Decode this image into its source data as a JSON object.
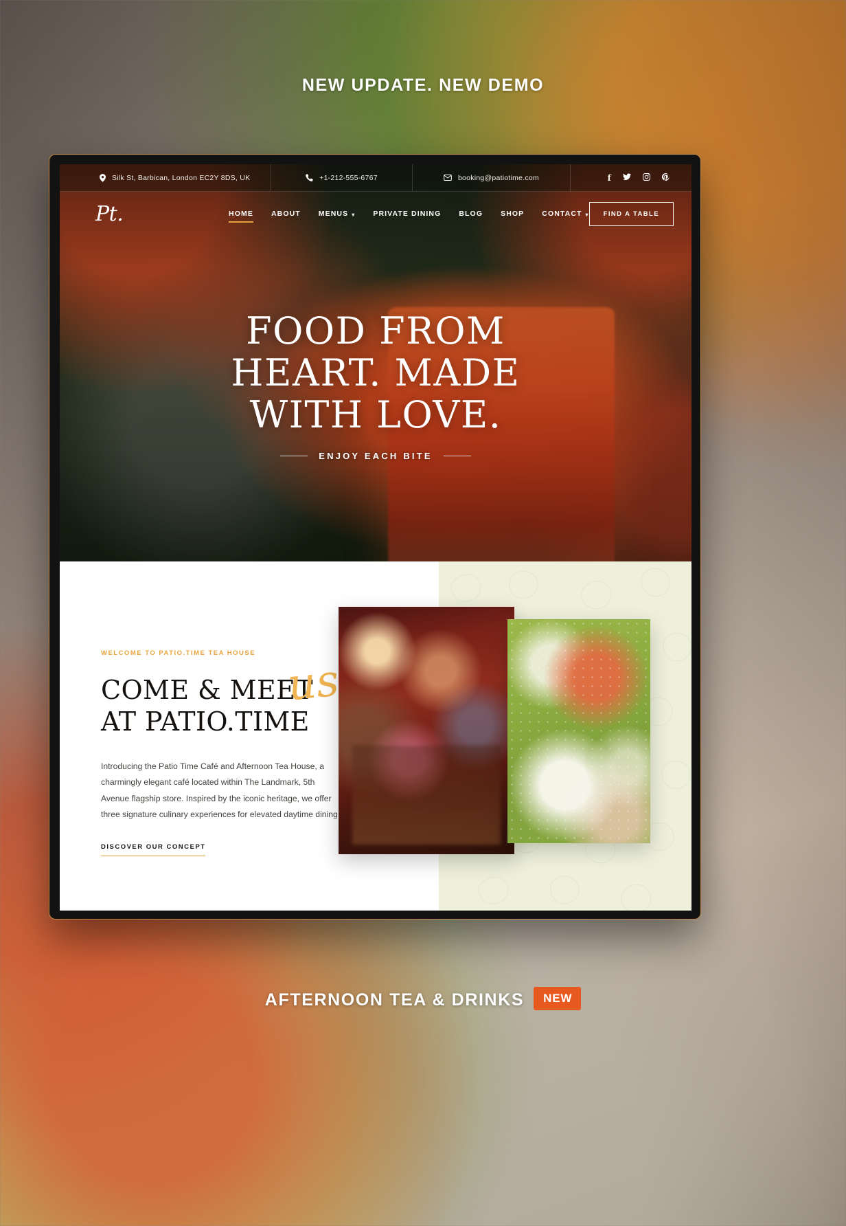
{
  "promo": {
    "top_caption": "NEW UPDATE. NEW DEMO",
    "bottom_caption": "AFTERNOON TEA & DRINKS",
    "badge": "NEW",
    "badge_color": "#e8591f"
  },
  "site": {
    "topbar": {
      "address": "Silk St, Barbican, London EC2Y 8DS, UK",
      "address_icon": "map-pin-icon",
      "phone": "+1-212-555-6767",
      "phone_icon": "phone-icon",
      "email": "booking@patiotime.com",
      "email_icon": "envelope-icon",
      "social": [
        {
          "name": "facebook-icon",
          "glyph": "f"
        },
        {
          "name": "twitter-icon",
          "glyph": "t"
        },
        {
          "name": "instagram-icon",
          "glyph": "i"
        },
        {
          "name": "pinterest-icon",
          "glyph": "p"
        }
      ]
    },
    "nav": {
      "logo": "Pt.",
      "items": [
        {
          "label": "HOME",
          "active": true,
          "has_caret": false
        },
        {
          "label": "ABOUT",
          "active": false,
          "has_caret": false
        },
        {
          "label": "MENUS",
          "active": false,
          "has_caret": true
        },
        {
          "label": "PRIVATE DINING",
          "active": false,
          "has_caret": false
        },
        {
          "label": "BLOG",
          "active": false,
          "has_caret": false
        },
        {
          "label": "SHOP",
          "active": false,
          "has_caret": false
        },
        {
          "label": "CONTACT",
          "active": false,
          "has_caret": true
        }
      ],
      "cta_label": "FIND A TABLE",
      "active_underline_color": "#e6a23a"
    },
    "hero": {
      "line1": "FOOD FROM",
      "line2": "HEART. MADE",
      "line3": "WITH LOVE.",
      "subtitle": "ENJOY EACH BITE"
    },
    "about": {
      "kicker": "WELCOME TO PATIO.TIME TEA HOUSE",
      "heading_line1": "COME & MEET",
      "heading_line2": "AT PATIO.TIME",
      "script_word": "us",
      "paragraph": "Introducing the Patio Time Café and Afternoon Tea House, a charmingly elegant café located within The Landmark, 5th Avenue flagship store. Inspired by the iconic heritage, we offer three signature culinary experiences for elevated daytime dining.",
      "link_label": "DISCOVER OUR CONCEPT",
      "accent_color": "#e8a43c"
    }
  }
}
